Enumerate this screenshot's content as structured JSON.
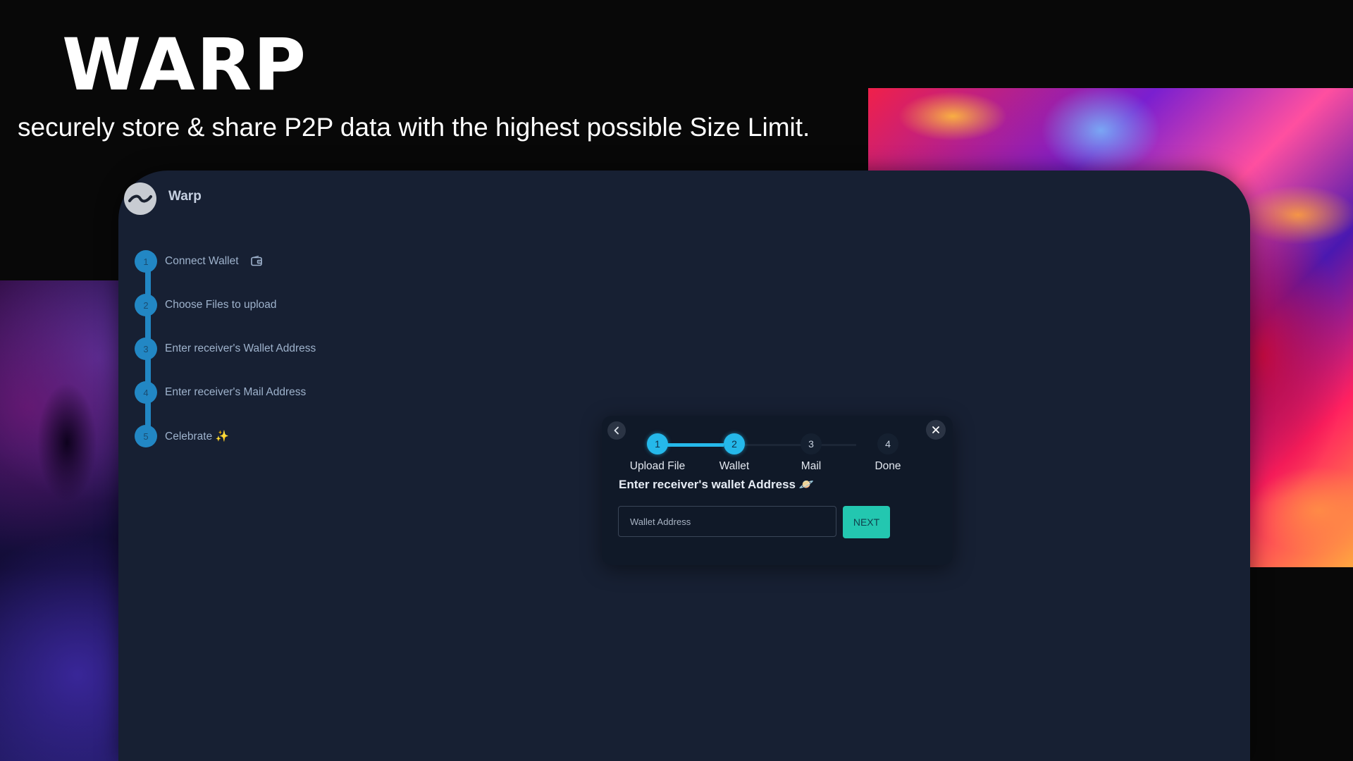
{
  "hero": {
    "title": "WARP",
    "subtitle": "securely store & share P2P data with the highest possible Size Limit."
  },
  "app": {
    "brand_name": "Warp",
    "logo_icon": "warp-wave-logo"
  },
  "sidebar": {
    "steps": [
      {
        "number": "1",
        "label": "Connect Wallet",
        "icon": "wallet-icon"
      },
      {
        "number": "2",
        "label": "Choose Files to upload"
      },
      {
        "number": "3",
        "label": "Enter receiver's Wallet Address"
      },
      {
        "number": "4",
        "label": "Enter receiver's Mail Address"
      },
      {
        "number": "5",
        "label": "Celebrate ✨"
      }
    ]
  },
  "modal": {
    "back_icon": "chevron-left-icon",
    "close_icon": "close-icon",
    "progress": [
      {
        "number": "1",
        "label": "Upload File",
        "state": "complete"
      },
      {
        "number": "2",
        "label": "Wallet",
        "state": "active"
      },
      {
        "number": "3",
        "label": "Mail",
        "state": "pending"
      },
      {
        "number": "4",
        "label": "Done",
        "state": "pending"
      }
    ],
    "heading": "Enter receiver's wallet Address 🪐",
    "wallet_input": {
      "placeholder": "Wallet Address",
      "value": ""
    },
    "next_label": "NEXT"
  },
  "colors": {
    "accent": "#25b8ea",
    "sidebar_step": "#2287c4",
    "next_button": "#23c7b0",
    "window_bg": "#172033",
    "modal_bg": "#101928"
  }
}
